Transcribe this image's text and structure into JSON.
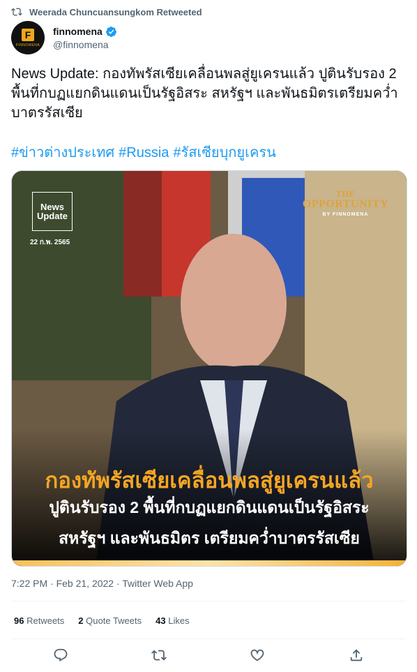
{
  "retweet": {
    "text": "Weerada Chuncuansungkom Retweeted"
  },
  "author": {
    "name": "finnomena",
    "handle": "@finnomena"
  },
  "avatar": {
    "logo_letter": "F",
    "logo_text": "FINNOMENA"
  },
  "tweet": {
    "text": "News Update: กองทัพรัสเซียเคลื่อนพลสู่ยูเครนแล้ว ปูตินรับรอง 2 พื้นที่กบฏแยกดินแดนเป็นรัฐอิสระ สหรัฐฯ และพันธมิตรเตรียมคว่ำบาตรรัสเซีย",
    "hashtags": [
      "#ข่าวต่างประเทศ",
      "#Russia",
      "#รัสเซียบุกยูเครน"
    ]
  },
  "media": {
    "badge_line1": "News",
    "badge_line2": "Update",
    "date": "22 ก.พ. 2565",
    "brand_the": "THE",
    "brand_opportunity": "OPPORTUNITY",
    "brand_by": "BY FINNOMENA",
    "headline1": "กองทัพรัสเซียเคลื่อนพลสู่ยูเครนแล้ว",
    "headline2": "ปูตินรับรอง 2 พื้นที่กบฏแยกดินแดนเป็นรัฐอิสระ",
    "headline3": "สหรัฐฯ และพันธมิตร เตรียมคว่ำบาตรรัสเซีย"
  },
  "meta": {
    "time": "7:22 PM · Feb 21, 2022 · Twitter Web App"
  },
  "stats": {
    "retweets_count": "96",
    "retweets_label": "Retweets",
    "quotes_count": "2",
    "quotes_label": "Quote Tweets",
    "likes_count": "43",
    "likes_label": "Likes"
  },
  "colors": {
    "link": "#1d9bf0",
    "muted": "#536471",
    "accent_headline": "#f6a623"
  },
  "icons": [
    "retweet-icon",
    "verified-icon",
    "reply-icon",
    "like-icon",
    "share-icon"
  ]
}
